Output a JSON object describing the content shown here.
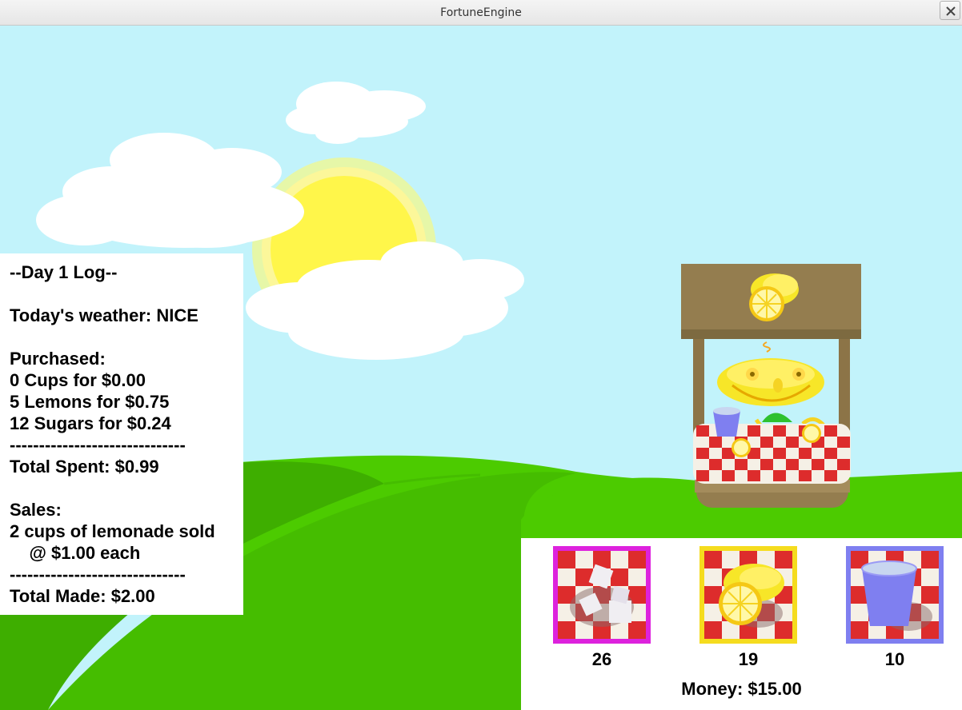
{
  "window": {
    "title": "FortuneEngine"
  },
  "log": {
    "lines": [
      "--Day 1 Log--",
      "",
      "Today's weather: NICE",
      "",
      "Purchased:",
      "0 Cups for $0.00",
      "5 Lemons for $0.75",
      "12 Sugars for $0.24",
      "------------------------------",
      "Total Spent: $0.99",
      "",
      "Sales:",
      "2 cups of lemonade sold",
      "    @ $1.00 each",
      "------------------------------",
      "Total Made: $2.00"
    ]
  },
  "inventory": {
    "items": [
      {
        "name": "sugar",
        "icon": "sugar-cubes-icon",
        "count": "26",
        "border_color": "#dd22dd"
      },
      {
        "name": "lemons",
        "icon": "lemon-icon",
        "count": "19",
        "border_color": "#f5dc1e"
      },
      {
        "name": "cups",
        "icon": "cup-icon",
        "count": "10",
        "border_color": "#7f7ff0"
      }
    ],
    "money": "Money: $15.00"
  },
  "colors": {
    "sky": "#c2f3fb",
    "grass": "#4ccb00",
    "grass_dark": "#3eae00",
    "sun": "#fff64a",
    "stand_wood": "#947d4f",
    "checker_red": "#dd2c2c"
  }
}
